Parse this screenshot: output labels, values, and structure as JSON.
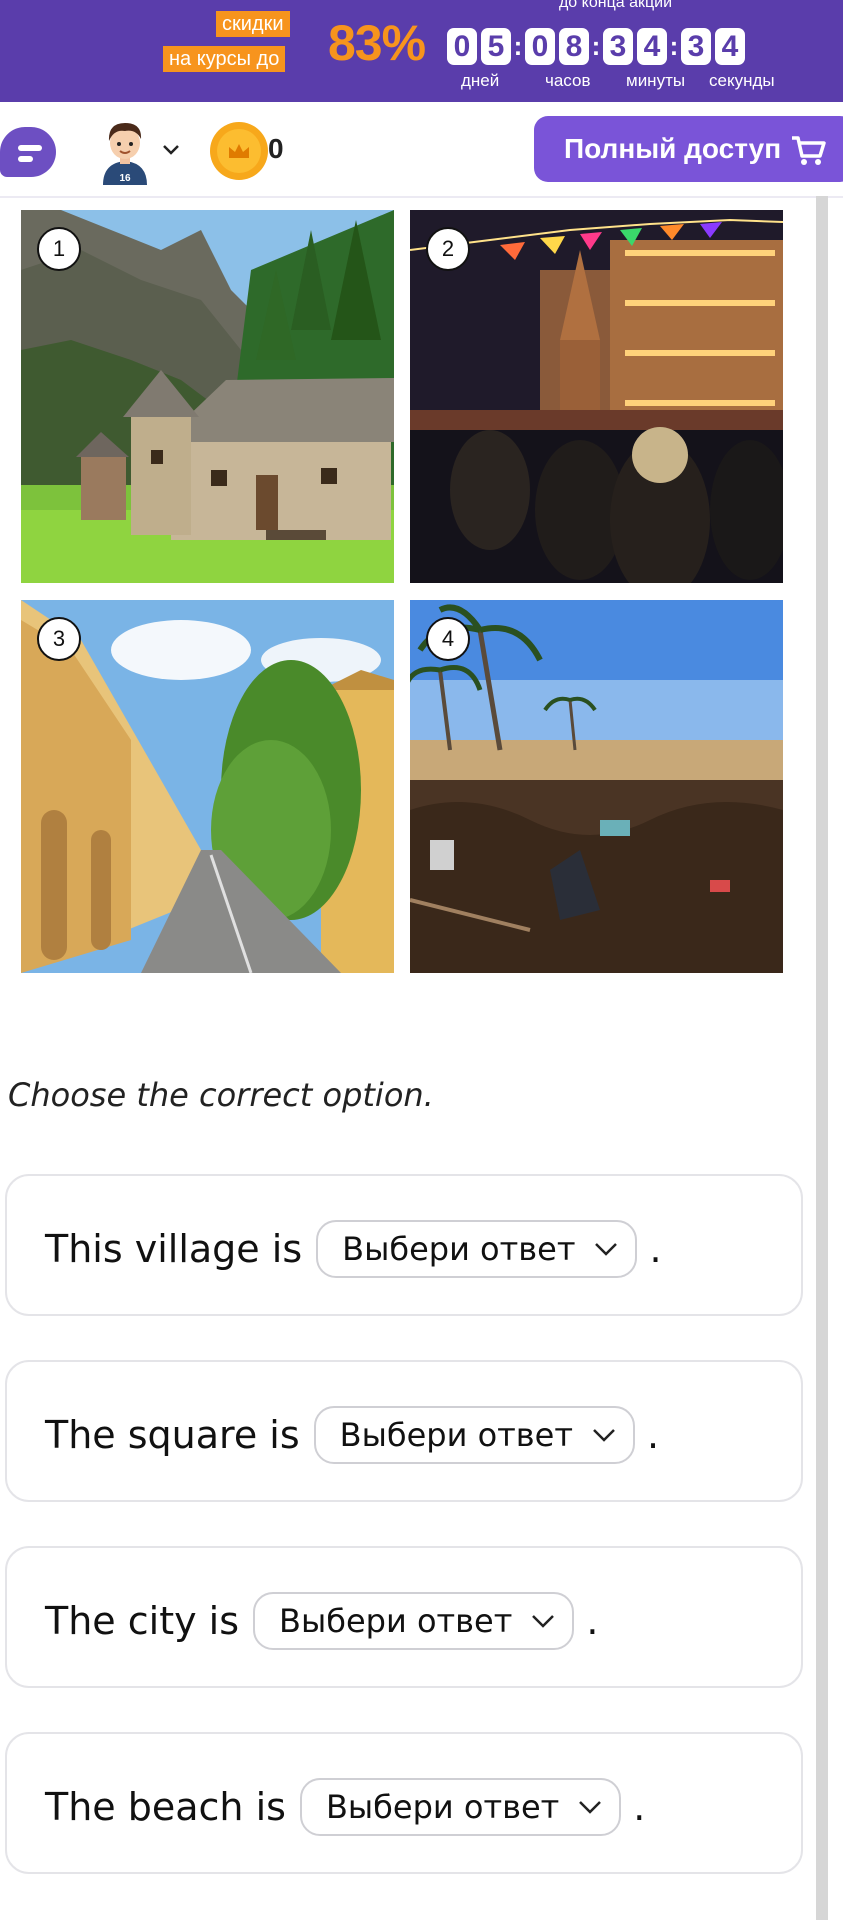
{
  "promo": {
    "until_end": "до конца акции",
    "badge_line1": "скидки",
    "badge_line2": "на курсы до",
    "percent": "83%",
    "timer": [
      {
        "d1": "0",
        "d2": "5",
        "label": "дней"
      },
      {
        "d1": "0",
        "d2": "8",
        "label": "часов"
      },
      {
        "d1": "3",
        "d2": "4",
        "label": "минуты"
      },
      {
        "d1": "3",
        "d2": "4",
        "label": "секунды"
      }
    ]
  },
  "nav": {
    "coins": "0",
    "full_access": "Полный доступ",
    "avatar_number": "16"
  },
  "photos": [
    {
      "number": "1",
      "subject": "village"
    },
    {
      "number": "2",
      "subject": "square"
    },
    {
      "number": "3",
      "subject": "city"
    },
    {
      "number": "4",
      "subject": "beach"
    }
  ],
  "exercise": {
    "instruction": "Choose the correct option.",
    "questions": [
      {
        "text": "This village is",
        "select": "Выбери ответ",
        "end": "."
      },
      {
        "text": "The square is",
        "select": "Выбери ответ",
        "end": "."
      },
      {
        "text": "The city is",
        "select": "Выбери ответ",
        "end": "."
      },
      {
        "text": "The beach is",
        "select": "Выбери ответ",
        "end": "."
      }
    ]
  },
  "colors": {
    "brand_purple": "#5a3dab",
    "button_purple": "#7a54d8",
    "accent_orange": "#f7941d"
  },
  "icons": [
    "chat-icon",
    "avatar-icon",
    "chevron-down-icon",
    "crown-coin-icon",
    "cart-icon"
  ]
}
